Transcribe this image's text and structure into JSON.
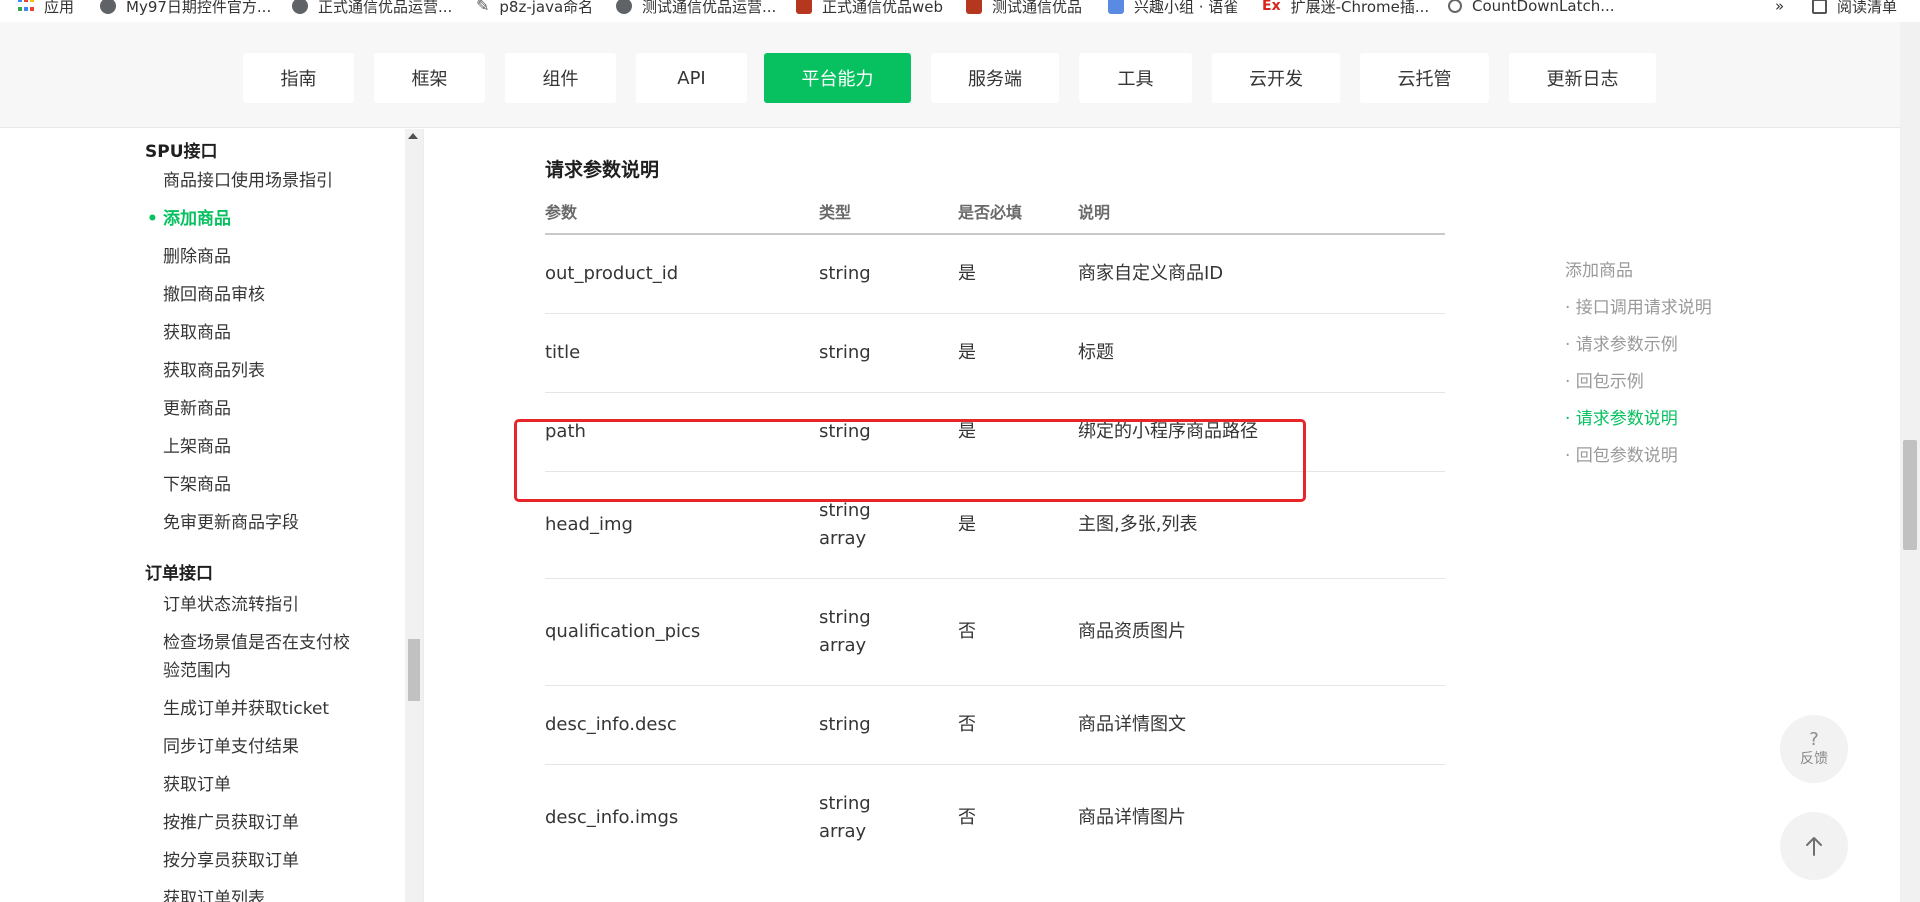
{
  "bookmarks": {
    "items": [
      {
        "label": "应用",
        "icon": "apps-icon"
      },
      {
        "label": "My97日期控件官方...",
        "icon": "globe-icon"
      },
      {
        "label": "正式通信优品运营...",
        "icon": "globe-icon"
      },
      {
        "label": "p8z-java命名",
        "icon": "feather-icon"
      },
      {
        "label": "测试通信优品运营...",
        "icon": "globe-icon"
      },
      {
        "label": "正式通信优品web",
        "icon": "monkey-icon"
      },
      {
        "label": "测试通信优品",
        "icon": "monkey-icon"
      },
      {
        "label": "兴趣小组 · 语雀",
        "icon": "box-icon"
      },
      {
        "label": "扩展迷-Chrome插...",
        "icon": "ex-icon"
      },
      {
        "label": "CountDownLatch...",
        "icon": "countdown-icon"
      }
    ],
    "overflow": "»",
    "reading_list": "阅读清单"
  },
  "nav": {
    "items": [
      {
        "label": "指南"
      },
      {
        "label": "框架"
      },
      {
        "label": "组件"
      },
      {
        "label": "API"
      },
      {
        "label": "平台能力",
        "active": true
      },
      {
        "label": "服务端"
      },
      {
        "label": "工具"
      },
      {
        "label": "云开发"
      },
      {
        "label": "云托管"
      },
      {
        "label": "更新日志"
      }
    ],
    "accent": "#07c160"
  },
  "sidebar": {
    "section_spu": "SPU接口",
    "spu_items": [
      {
        "label": "商品接口使用场景指引"
      },
      {
        "label": "添加商品",
        "active": true
      },
      {
        "label": "删除商品"
      },
      {
        "label": "撤回商品审核"
      },
      {
        "label": "获取商品"
      },
      {
        "label": "获取商品列表"
      },
      {
        "label": "更新商品"
      },
      {
        "label": "上架商品"
      },
      {
        "label": "下架商品"
      },
      {
        "label": "免审更新商品字段"
      }
    ],
    "section_order": "订单接口",
    "order_items": [
      {
        "label": "订单状态流转指引"
      },
      {
        "label": "检查场景值是否在支付校"
      },
      {
        "label": "验范围内"
      },
      {
        "label": "生成订单并获取ticket"
      },
      {
        "label": "同步订单支付结果"
      },
      {
        "label": "获取订单"
      },
      {
        "label": "按推广员获取订单"
      },
      {
        "label": "按分享员获取订单"
      },
      {
        "label": "获取订单列表"
      }
    ]
  },
  "main": {
    "section_title": "请求参数说明",
    "table": {
      "headers": [
        "参数",
        "类型",
        "是否必填",
        "说明"
      ],
      "rows": [
        {
          "param": "out_product_id",
          "type": "string",
          "type2": "",
          "required": "是",
          "desc": "商家自定义商品ID"
        },
        {
          "param": "title",
          "type": "string",
          "type2": "",
          "required": "是",
          "desc": "标题"
        },
        {
          "param": "path",
          "type": "string",
          "type2": "",
          "required": "是",
          "desc": "绑定的小程序商品路径"
        },
        {
          "param": "head_img",
          "type": "string",
          "type2": "array",
          "required": "是",
          "desc": "主图,多张,列表"
        },
        {
          "param": "qualification_pics",
          "type": "string",
          "type2": "array",
          "required": "否",
          "desc": "商品资质图片"
        },
        {
          "param": "desc_info.desc",
          "type": "string",
          "type2": "",
          "required": "否",
          "desc": "商品详情图文"
        },
        {
          "param": "desc_info.imgs",
          "type": "string",
          "type2": "array",
          "required": "否",
          "desc": "商品详情图片"
        }
      ]
    },
    "highlight_color": "#e8262a"
  },
  "toc": {
    "items": [
      {
        "label": "添加商品"
      },
      {
        "label": "· 接口调用请求说明"
      },
      {
        "label": "· 请求参数示例"
      },
      {
        "label": "· 回包示例"
      },
      {
        "label": "· 请求参数说明",
        "active": true
      },
      {
        "label": "· 回包参数说明"
      }
    ]
  },
  "float": {
    "feedback_glyph": "?",
    "feedback_label": "反馈",
    "top_icon": "arrow-up-icon"
  }
}
